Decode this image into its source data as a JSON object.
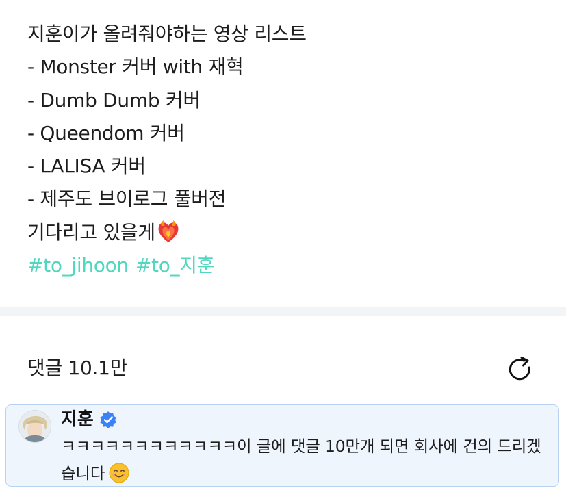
{
  "post": {
    "lines": [
      "지훈이가 올려줘야하는 영상 리스트",
      "- Monster 커버 with 재혁",
      "- Dumb Dumb 커버",
      "- Queendom 커버",
      "- LALISA 커버",
      "- 제주도 브이로그 풀버전",
      "기다리고 있을게"
    ],
    "emoji": "heart-on-fire-icon",
    "hashtags": [
      "#to_jihoon",
      "#to_지훈"
    ],
    "hashtag_color": "#4fd8bf"
  },
  "comments": {
    "header": "댓글 10.1만",
    "refresh_icon": "refresh-icon"
  },
  "highlighted_comment": {
    "author": "지훈",
    "verified_icon": "verified-badge-icon",
    "text": "ㅋㅋㅋㅋㅋㅋㅋㅋㅋㅋㅋㅋ이 글에 댓글 10만개 되면 회사에 건의 드리겠습니다",
    "emoji": "smiling-face-icon",
    "border_color": "#b8d3f2",
    "background_color": "#eef5fd"
  }
}
